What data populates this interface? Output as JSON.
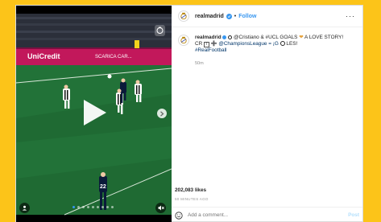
{
  "post": {
    "username": "realmadrid",
    "follow_label": "Follow",
    "more_label": "···",
    "separator": "•"
  },
  "caption": {
    "author": "realmadrid",
    "line1": "@Cristiano & #UCL GOALS",
    "line1b": "A LOVE STORY!",
    "line2a": "CR",
    "line2b": "@ChampionsLeague = ¡G",
    "line2c": "LES!",
    "hashtag": "#RealFootball",
    "time": "50m"
  },
  "engagement": {
    "likes": "202,083 likes",
    "posted": "50 MINUTES AGO"
  },
  "comment": {
    "placeholder": "Add a comment...",
    "post_label": "Post"
  },
  "media": {
    "banner_text": "UniCredit",
    "banner_text2": "SCARICA CAR...",
    "player_number": "22",
    "carousel_total": 9,
    "carousel_active": 0
  },
  "colors": {
    "page_bg": "#fcc419",
    "accent": "#3897f0",
    "text": "#262626"
  },
  "icons": [
    "realmadrid-crest-icon",
    "verified-badge-icon",
    "more-options-icon",
    "play-icon",
    "next-arrow-icon",
    "account-icon",
    "mute-icon",
    "emoji-icon"
  ]
}
